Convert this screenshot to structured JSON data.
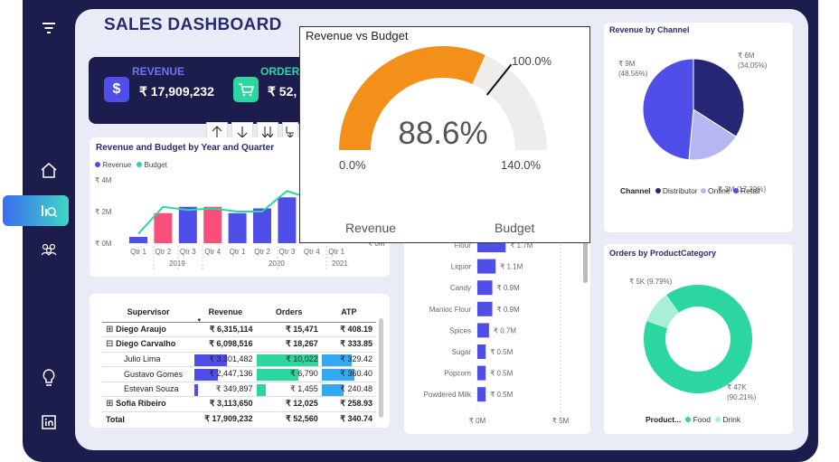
{
  "header": {
    "title": "SALES DASHBOARD"
  },
  "kpis": {
    "revenue": {
      "label": "REVENUE",
      "value": "₹ 17,909,232",
      "icon": "dollar-icon"
    },
    "orders": {
      "label": "ORDER",
      "value": "₹ 52,",
      "icon": "cart-icon"
    }
  },
  "sidebar": {
    "items": [
      {
        "name": "menu",
        "icon": "filter-icon"
      },
      {
        "name": "home",
        "icon": "home-icon"
      },
      {
        "name": "analytics",
        "icon": "analytics-icon",
        "active": true
      },
      {
        "name": "people",
        "icon": "people-icon"
      },
      {
        "name": "idea",
        "icon": "bulb-icon"
      },
      {
        "name": "linkedin",
        "icon": "linkedin-icon"
      }
    ]
  },
  "colors": {
    "accent_blue": "#4f4ee8",
    "accent_pink": "#f74f7a",
    "accent_green": "#2bd6a0",
    "orange": "#f39019",
    "navy": "#1c1d4c",
    "dark_blue": "#262b73"
  },
  "year_chart": {
    "title": "Revenue and Budget by Year and Quarter",
    "legend": [
      "Revenue",
      "Budget"
    ],
    "y_ticks": [
      "₹ 4M",
      "₹ 2M",
      "₹ 0M"
    ],
    "quarters": [
      "Qtr 1",
      "Qtr 2",
      "Qtr 3",
      "Qtr 4",
      "Qtr 1",
      "Qtr 2",
      "Qtr 3",
      "Qtr 4",
      "Qtr 1"
    ],
    "years": [
      "2019",
      "2020",
      "2021"
    ],
    "extra_tick": "₹ 0M"
  },
  "chart_data": [
    {
      "type": "bar",
      "title": "Revenue and Budget by Year and Quarter",
      "categories": [
        "2019 Qtr 1",
        "2019 Qtr 2",
        "2019 Qtr 3",
        "2019 Qtr 4",
        "2020 Qtr 1",
        "2020 Qtr 2",
        "2020 Qtr 3",
        "2020 Qtr 4",
        "2021 Qtr 1"
      ],
      "series": [
        {
          "name": "Revenue",
          "values": [
            0.4,
            1.9,
            2.3,
            2.3,
            1.9,
            2.2,
            2.9,
            2.9,
            0
          ]
        },
        {
          "name": "Budget",
          "values": [
            0.6,
            2.3,
            2.1,
            2.2,
            2.0,
            2.0,
            3.3,
            2.8,
            0
          ]
        }
      ],
      "ylim": [
        0,
        4
      ]
    },
    {
      "type": "bar",
      "categories": [
        "Flour",
        "Liquor",
        "Candy",
        "Manioc Flour",
        "Spices",
        "Sugar",
        "Popcorn",
        "Powdered Milk"
      ],
      "values": [
        1.7,
        1.1,
        0.9,
        0.9,
        0.7,
        0.5,
        0.5,
        0.5
      ],
      "labels": [
        "₹ 1.7M",
        "₹ 1.1M",
        "₹ 0.9M",
        "₹ 0.9M",
        "₹ 0.7M",
        "₹ 0.5M",
        "₹ 0.5M",
        "₹ 0.5M"
      ],
      "x_ticks": [
        "₹ 0M",
        "₹ 5M"
      ],
      "xlim": [
        0,
        5
      ]
    },
    {
      "type": "pie",
      "title": "Revenue by Channel",
      "legend_title": "Channel",
      "slices": [
        {
          "name": "Distributor",
          "value": 34.05,
          "label": "₹ 6M\n(34.05%)",
          "color": "#252674"
        },
        {
          "name": "Online",
          "value": 17.39,
          "label": "₹ 3M (17.39%)",
          "color": "#b7b6f5"
        },
        {
          "name": "Retail",
          "value": 48.56,
          "label": "₹ 9M\n(48.56%)",
          "color": "#4f4ee8"
        }
      ]
    },
    {
      "type": "pie",
      "title": "Orders by ProductCategory",
      "legend_title": "Product...",
      "slices": [
        {
          "name": "Food",
          "value": 90.21,
          "label": "₹ 47K\n(90.21%)",
          "color": "#2bd6a0"
        },
        {
          "name": "Drink",
          "value": 9.79,
          "label": "₹ 5K (9.79%)",
          "color": "#a9eed6"
        }
      ]
    }
  ],
  "gauge": {
    "title": "Revenue vs Budget",
    "value_text": "88.6%",
    "value": 88.6,
    "min_label": "0.0%",
    "max_label": "140.0%",
    "target_label": "100.0%",
    "min": 0,
    "max": 140,
    "target": 100,
    "left_caption": "Revenue",
    "right_caption": "Budget"
  },
  "product_chart": {
    "categories": [
      "Flour",
      "Liquor",
      "Candy",
      "Manioc Flour",
      "Spices",
      "Sugar",
      "Popcorn",
      "Powdered Milk"
    ],
    "labels": [
      "₹ 1.7M",
      "₹ 1.1M",
      "₹ 0.9M",
      "₹ 0.9M",
      "₹ 0.7M",
      "₹ 0.5M",
      "₹ 0.5M",
      "₹ 0.5M"
    ],
    "x_ticks": [
      "₹ 0M",
      "₹ 5M"
    ]
  },
  "channel_chart": {
    "title": "Revenue by Channel",
    "legend_title": "Channel",
    "legend": [
      "Distributor",
      "Online",
      "Retail"
    ],
    "labels": [
      "₹ 6M",
      "(34.05%)",
      "₹ 9M",
      "(48.56%)",
      "₹ 3M (17.39%)"
    ]
  },
  "category_chart": {
    "title": "Orders by ProductCategory",
    "legend_title": "Product...",
    "legend": [
      "Food",
      "Drink"
    ],
    "labels": [
      "₹ 5K (9.79%)",
      "₹ 47K",
      "(90.21%)"
    ]
  },
  "matrix": {
    "columns": [
      "Supervisor",
      "Revenue",
      "Orders",
      "ATP"
    ],
    "rows": [
      {
        "name": "Diego Araujo",
        "expander": "⊞",
        "level": 0,
        "revenue": "₹ 6,315,114",
        "orders": "₹ 15,471",
        "atp": "₹ 408.19",
        "bold": true
      },
      {
        "name": "Diego Carvalho",
        "expander": "⊟",
        "level": 0,
        "revenue": "₹ 6,098,516",
        "orders": "₹ 18,267",
        "atp": "₹ 333.85",
        "bold": true
      },
      {
        "name": "Julio Lima",
        "expander": "",
        "level": 1,
        "revenue": "₹ 3,301,482",
        "orders": "₹ 10,022",
        "atp": "₹ 329.42",
        "rev_bar": 0.52,
        "ord_bar": 0.95,
        "atp_bar": 0.55
      },
      {
        "name": "Gustavo Gomes",
        "expander": "",
        "level": 1,
        "revenue": "₹ 2,447,136",
        "orders": "₹ 6,790",
        "atp": "₹ 360.40",
        "rev_bar": 0.38,
        "ord_bar": 0.65,
        "atp_bar": 0.6
      },
      {
        "name": "Estevan Souza",
        "expander": "",
        "level": 1,
        "revenue": "₹ 349,897",
        "orders": "₹ 1,455",
        "atp": "₹ 240.48",
        "rev_bar": 0.06,
        "ord_bar": 0.14,
        "atp_bar": 0.4
      },
      {
        "name": "Sofia Ribeiro",
        "expander": "⊞",
        "level": 0,
        "revenue": "₹ 3,113,650",
        "orders": "₹ 12,025",
        "atp": "₹ 258.93",
        "bold": true
      },
      {
        "name": "Total",
        "expander": "",
        "level": 0,
        "revenue": "₹ 17,909,232",
        "orders": "₹ 52,560",
        "atp": "₹ 340.74",
        "bold": true
      }
    ]
  },
  "drill_buttons": [
    "up-arrow-icon",
    "down-arrow-icon",
    "double-down-arrow-icon",
    "expand-down-icon"
  ]
}
